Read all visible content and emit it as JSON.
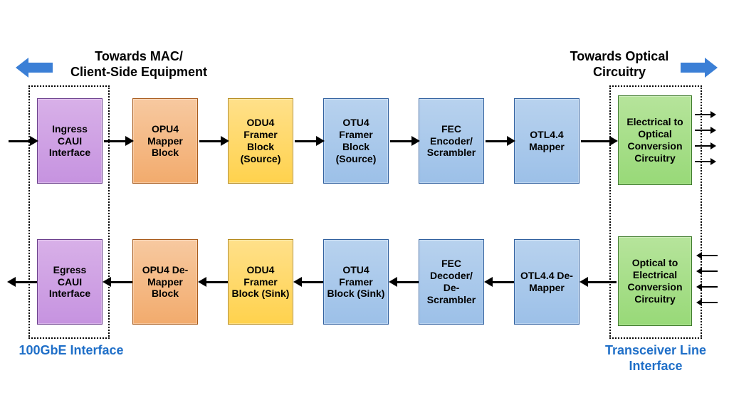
{
  "labels": {
    "top_left": "Towards MAC/\nClient-Side Equipment",
    "top_right": "Towards Optical\nCircuitry",
    "bottom_left": "100GbE Interface",
    "bottom_right": "Transceiver Line\nInterface"
  },
  "rows": {
    "top": [
      {
        "text": "Ingress CAUI Interface",
        "color": "purple"
      },
      {
        "text": "OPU4 Mapper Block",
        "color": "orange"
      },
      {
        "text": "ODU4 Framer Block (Source)",
        "color": "yellow"
      },
      {
        "text": "OTU4 Framer Block (Source)",
        "color": "blue"
      },
      {
        "text": "FEC Encoder/ Scrambler",
        "color": "blue"
      },
      {
        "text": "OTL4.4 Mapper",
        "color": "blue"
      },
      {
        "text": "Electrical to Optical Conversion Circuitry",
        "color": "green"
      }
    ],
    "bottom": [
      {
        "text": "Egress CAUI Interface",
        "color": "purple"
      },
      {
        "text": "OPU4 De-Mapper Block",
        "color": "orange"
      },
      {
        "text": "ODU4 Framer Block (Sink)",
        "color": "yellow"
      },
      {
        "text": "OTU4 Framer Block (Sink)",
        "color": "blue"
      },
      {
        "text": "FEC Decoder/ De-Scrambler",
        "color": "blue"
      },
      {
        "text": "OTL4.4 De-Mapper",
        "color": "blue"
      },
      {
        "text": "Optical to Electrical Conversion Circuitry",
        "color": "green"
      }
    ]
  },
  "flow": {
    "top_direction": "right",
    "bottom_direction": "left"
  }
}
